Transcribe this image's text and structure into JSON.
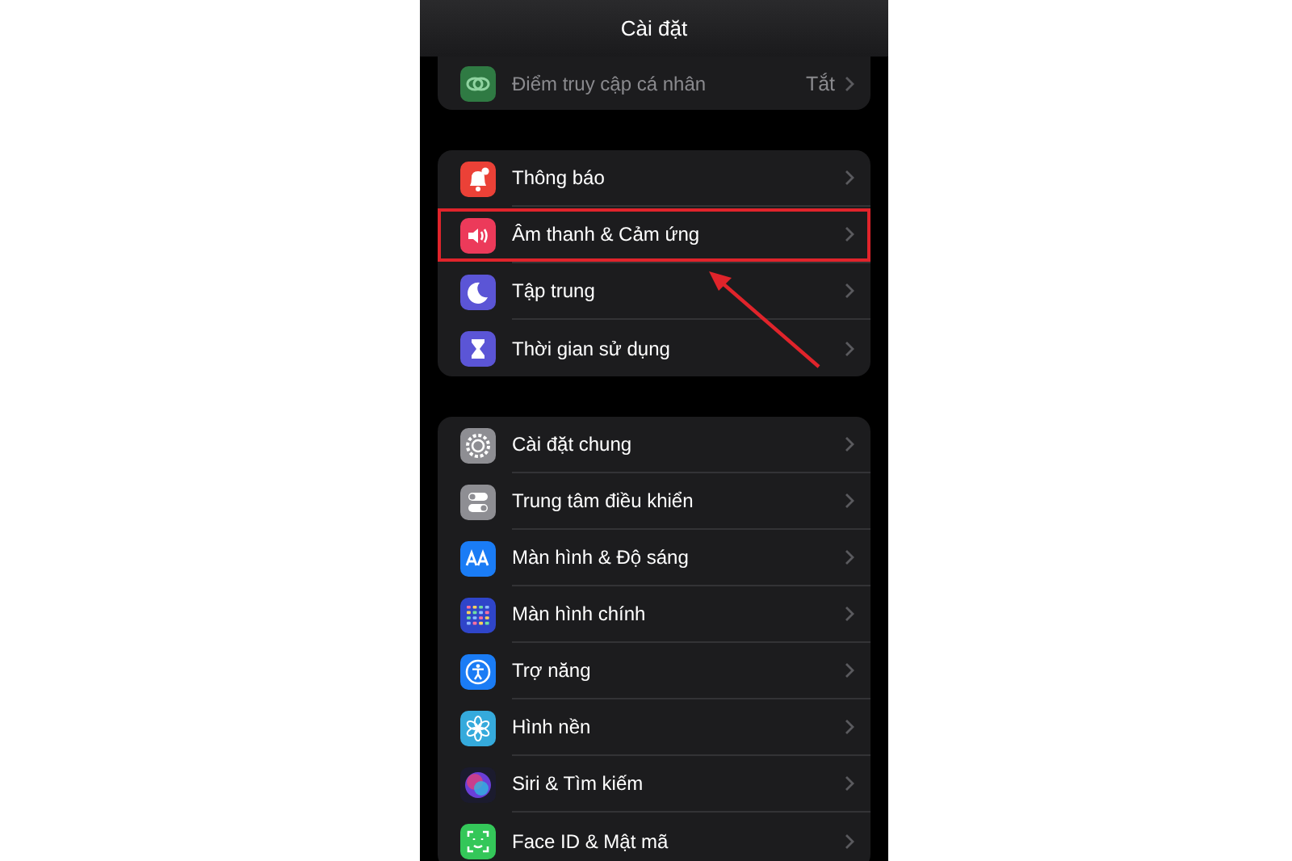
{
  "header": {
    "title": "Cài đặt"
  },
  "groups": [
    {
      "cut_top": true,
      "items": [
        {
          "kind": "hotspot",
          "label": "Điểm truy cập cá nhân",
          "value": "Tắt",
          "disabled": true,
          "highlighted": false
        }
      ]
    },
    {
      "cut_top": false,
      "items": [
        {
          "kind": "bell",
          "label": "Thông báo",
          "disabled": false,
          "highlighted": false
        },
        {
          "kind": "speaker",
          "label": "Âm thanh & Cảm ứng",
          "disabled": false,
          "highlighted": true
        },
        {
          "kind": "moon",
          "label": "Tập trung",
          "disabled": false,
          "highlighted": false
        },
        {
          "kind": "hourglass",
          "label": "Thời gian sử dụng",
          "disabled": false,
          "highlighted": false
        }
      ]
    },
    {
      "cut_top": false,
      "items": [
        {
          "kind": "gear",
          "label": "Cài đặt chung",
          "disabled": false,
          "highlighted": false
        },
        {
          "kind": "toggles",
          "label": "Trung tâm điều khiển",
          "disabled": false,
          "highlighted": false
        },
        {
          "kind": "aa",
          "label": "Màn hình & Độ sáng",
          "disabled": false,
          "highlighted": false
        },
        {
          "kind": "grid",
          "label": "Màn hình chính",
          "disabled": false,
          "highlighted": false
        },
        {
          "kind": "person",
          "label": "Trợ năng",
          "disabled": false,
          "highlighted": false
        },
        {
          "kind": "flower",
          "label": "Hình nền",
          "disabled": false,
          "highlighted": false
        },
        {
          "kind": "orb",
          "label": "Siri & Tìm kiếm",
          "disabled": false,
          "highlighted": false
        },
        {
          "kind": "face",
          "label": "Face ID & Mật mã",
          "disabled": false,
          "highlighted": false
        }
      ]
    }
  ]
}
